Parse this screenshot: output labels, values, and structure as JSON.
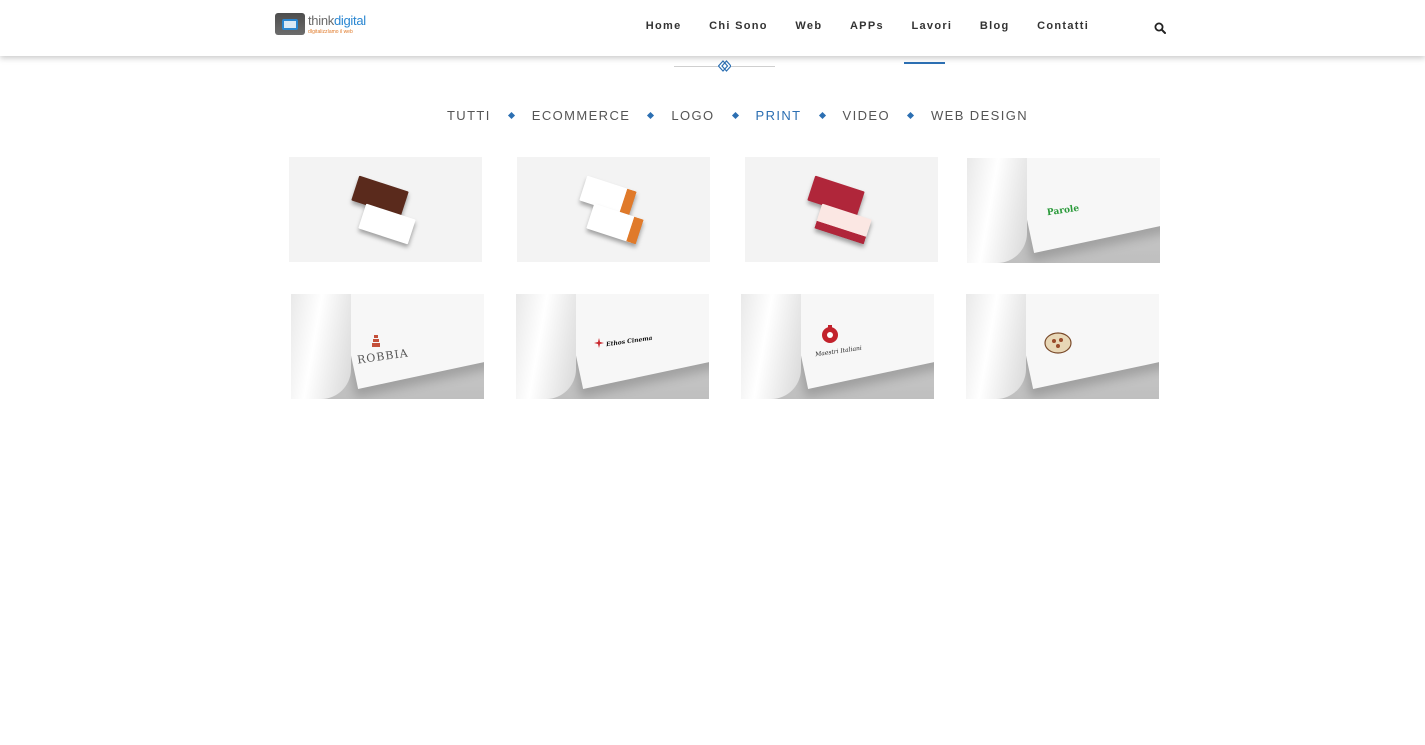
{
  "header": {
    "logo": {
      "name": "thinkdigital",
      "name_accent": "digital",
      "tagline": "dIgitalizzIamo il web"
    },
    "nav": [
      {
        "label": "Home"
      },
      {
        "label": "Chi Sono"
      },
      {
        "label": "Web"
      },
      {
        "label": "APPs"
      },
      {
        "label": "Lavori",
        "active": true
      },
      {
        "label": "Blog"
      },
      {
        "label": "Contatti"
      }
    ],
    "search_icon": "search-icon"
  },
  "filters": [
    {
      "label": "TUTTI"
    },
    {
      "label": "ECOMMERCE"
    },
    {
      "label": "LOGO"
    },
    {
      "label": "PRINT",
      "active": true
    },
    {
      "label": "VIDEO"
    },
    {
      "label": "WEB DESIGN"
    }
  ],
  "colors": {
    "accent": "#2c6fb2",
    "nav_text": "#333333",
    "filter_text": "#555555"
  },
  "portfolio": [
    {
      "type": "business-card",
      "colors": [
        "#5a2a1c",
        "#ffffff"
      ]
    },
    {
      "type": "business-card",
      "colors": [
        "#e07a2a",
        "#ffffff"
      ]
    },
    {
      "type": "business-card",
      "colors": [
        "#b0263a",
        "#ffffff"
      ]
    },
    {
      "type": "paper",
      "mark": "Parole"
    },
    {
      "type": "paper",
      "mark": "ROBBIA"
    },
    {
      "type": "paper",
      "mark": "Ethos Cinema"
    },
    {
      "type": "paper",
      "mark": "Maestri Italiani"
    },
    {
      "type": "paper",
      "mark": ""
    }
  ]
}
